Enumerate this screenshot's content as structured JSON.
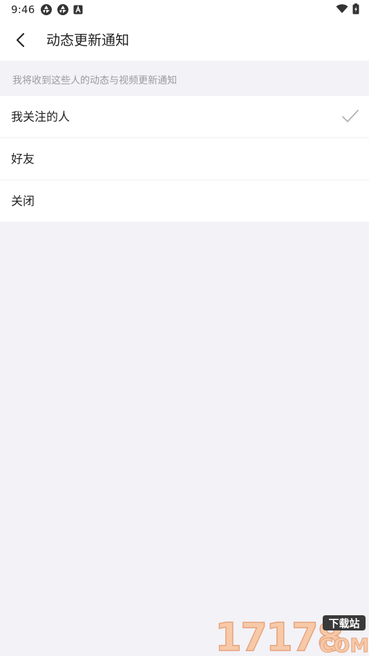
{
  "status_bar": {
    "time": "9:46"
  },
  "header": {
    "title": "动态更新通知",
    "back_icon": "chevron-left-icon"
  },
  "section": {
    "hint": "我将收到这些人的动态与视频更新通知"
  },
  "options": [
    {
      "label": "我关注的人",
      "selected": true
    },
    {
      "label": "好友",
      "selected": false
    },
    {
      "label": "关闭",
      "selected": false
    }
  ],
  "watermark": {
    "number": "17178",
    "badge": "下载站",
    "domain": "COM"
  },
  "colors": {
    "background": "#f2f2f7",
    "surface": "#ffffff",
    "text_primary": "#222222",
    "text_hint": "#9a9aa0",
    "check": "#b0b0b5"
  }
}
